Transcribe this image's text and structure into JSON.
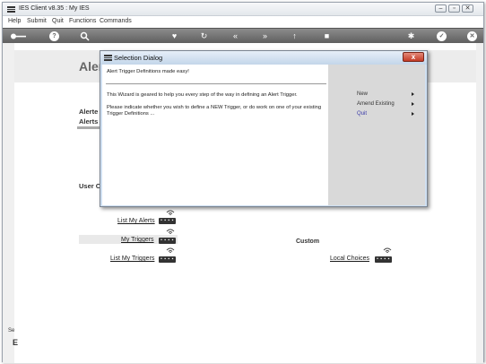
{
  "window": {
    "title": "IES Client v8.35 : My IES"
  },
  "menu": [
    "Help",
    "Submit",
    "Quit",
    "Functions",
    "Commands"
  ],
  "page": {
    "title": "Alert",
    "headers": {
      "alerted": "Alerte",
      "alerts": "Alerts",
      "user": "User O",
      "custom": "Custom"
    },
    "links": {
      "list_my_alerts": "List My Alerts",
      "my_triggers": "My Triggers",
      "list_my_triggers": "List My Triggers",
      "local_choices": "Local Choices"
    },
    "badge_text": "• ▪ ▪ ▪",
    "corner": {
      "top": "Se",
      "bottom": "E"
    }
  },
  "dialog": {
    "title": "Selection Dialog",
    "heading": "Alert Trigger Definitions made easy!",
    "intro": "This Wizard is geared to help you every step of the way in defining an Alert Trigger.",
    "prompt_line1": "Please indicate whether you wish to define a NEW Trigger, or do work on one of your existing",
    "prompt_line2": "Trigger Definitions ...",
    "options": [
      "New",
      "Amend Existing",
      "Quit"
    ],
    "close_label": "x"
  },
  "colors": {
    "quit_option": "#3a3aa8",
    "toolbar": "#6e6e6e",
    "dialog_close": "#c33b26"
  }
}
